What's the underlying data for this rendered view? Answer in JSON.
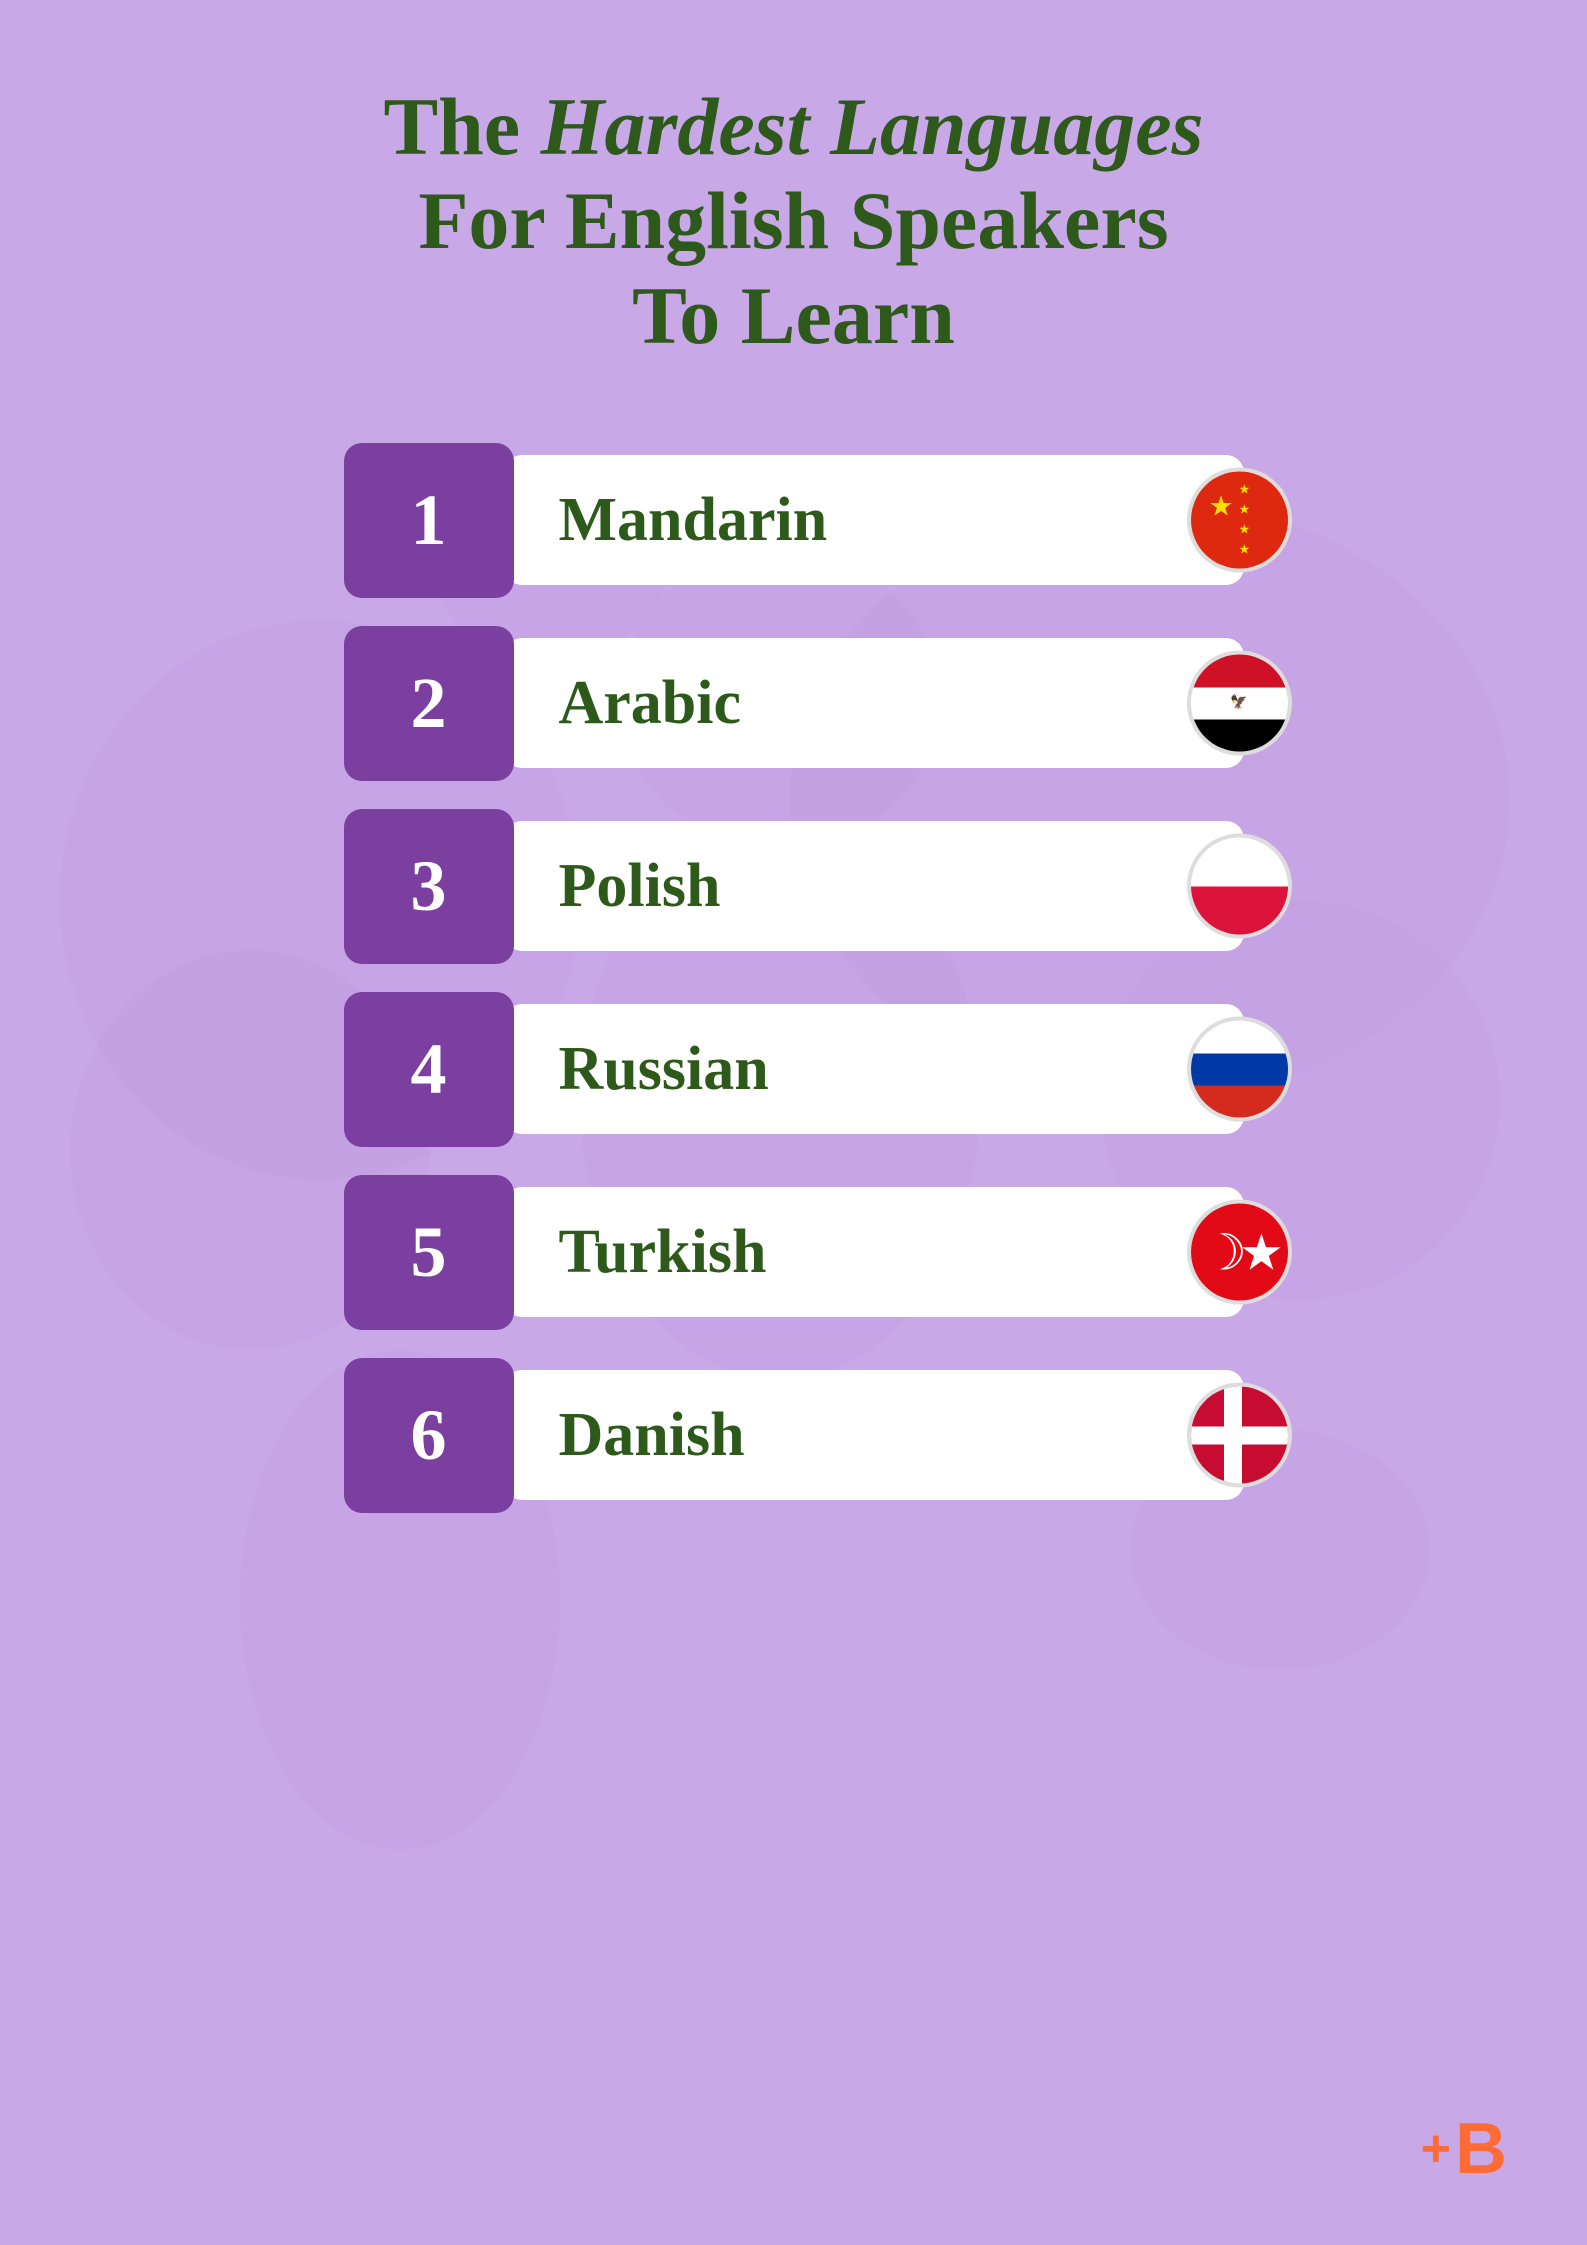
{
  "page": {
    "background_color": "#c9a8e8",
    "title_line1": "The ",
    "title_italic": "Hardest Languages",
    "title_line2": "For English Speakers",
    "title_line3": "To Learn",
    "title_color": "#2d5a1b"
  },
  "logo": {
    "symbol": "+B",
    "color": "#ff6b35"
  },
  "items": [
    {
      "rank": "1",
      "language": "Mandarin",
      "flag_type": "china"
    },
    {
      "rank": "2",
      "language": "Arabic",
      "flag_type": "egypt"
    },
    {
      "rank": "3",
      "language": "Polish",
      "flag_type": "poland"
    },
    {
      "rank": "4",
      "language": "Russian",
      "flag_type": "russia"
    },
    {
      "rank": "5",
      "language": "Turkish",
      "flag_type": "turkey"
    },
    {
      "rank": "6",
      "language": "Danish",
      "flag_type": "denmark"
    }
  ]
}
